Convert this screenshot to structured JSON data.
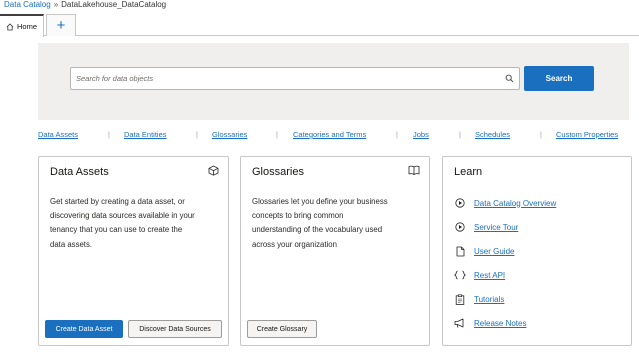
{
  "breadcrumb": {
    "root": "Data Catalog",
    "separator": "»",
    "current": "DataLakehouse_DataCatalog"
  },
  "tabs": {
    "home_label": "Home",
    "new_tab_label": "+"
  },
  "search": {
    "placeholder": "Search for data objects",
    "button_label": "Search"
  },
  "nav_links": [
    "Data Assets",
    "Data Entities",
    "Glossaries",
    "Categories and Terms",
    "Jobs",
    "Schedules",
    "Custom Properties"
  ],
  "cards": {
    "data_assets": {
      "title": "Data Assets",
      "icon": "cube-icon",
      "lines": [
        "Get started by creating a data asset, or",
        "discovering data sources available in your",
        "tenancy that you can use to create the",
        "data assets."
      ],
      "primary_button": "Create Data Asset",
      "secondary_button": "Discover Data Sources"
    },
    "glossaries": {
      "title": "Glossaries",
      "icon": "book-icon",
      "lines": [
        "Glossaries let you define your business",
        "concepts to bring common",
        "understanding of the vocabulary used",
        "across your organization"
      ],
      "button": "Create Glossary"
    },
    "learn": {
      "title": "Learn",
      "items": [
        {
          "label": "Data Catalog Overview",
          "icon": "play-circle-icon"
        },
        {
          "label": "Service Tour",
          "icon": "play-circle-icon"
        },
        {
          "label": "User Guide",
          "icon": "document-icon"
        },
        {
          "label": "Rest API",
          "icon": "braces-icon"
        },
        {
          "label": "Tutorials",
          "icon": "clipboard-icon"
        },
        {
          "label": "Release Notes",
          "icon": "megaphone-icon"
        }
      ]
    }
  },
  "colors": {
    "accent": "#1a6fbf",
    "panel": "#f1efed",
    "border": "#c9c7c5"
  }
}
